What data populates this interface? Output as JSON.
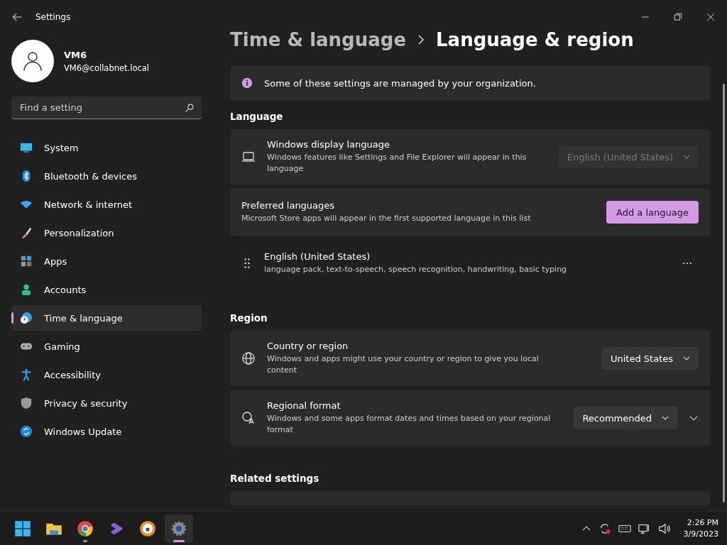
{
  "window": {
    "title": "Settings"
  },
  "user": {
    "name": "VM6",
    "email": "VM6@collabnet.local"
  },
  "search": {
    "placeholder": "Find a setting"
  },
  "sidebar": {
    "items": [
      {
        "label": "System",
        "selected": false
      },
      {
        "label": "Bluetooth & devices",
        "selected": false
      },
      {
        "label": "Network & internet",
        "selected": false
      },
      {
        "label": "Personalization",
        "selected": false
      },
      {
        "label": "Apps",
        "selected": false
      },
      {
        "label": "Accounts",
        "selected": false
      },
      {
        "label": "Time & language",
        "selected": true
      },
      {
        "label": "Gaming",
        "selected": false
      },
      {
        "label": "Accessibility",
        "selected": false
      },
      {
        "label": "Privacy & security",
        "selected": false
      },
      {
        "label": "Windows Update",
        "selected": false
      }
    ]
  },
  "breadcrumb": [
    "Time & language",
    "Language & region"
  ],
  "banner": "Some of these settings are managed by your organization.",
  "language": {
    "heading": "Language",
    "display": {
      "title": "Windows display language",
      "description": "Windows features like Settings and File Explorer will appear in this language",
      "value": "English (United States)",
      "disabled": true
    },
    "preferred": {
      "title": "Preferred languages",
      "description": "Microsoft Store apps will appear in the first supported language in this list",
      "button": "Add a language"
    },
    "languages": [
      {
        "name": "English (United States)",
        "features": "language pack, text-to-speech, speech recognition, handwriting, basic typing"
      }
    ]
  },
  "region": {
    "heading": "Region",
    "rows": [
      {
        "title": "Country or region",
        "description": "Windows and apps might use your country or region to give you local content",
        "value": "United States"
      },
      {
        "title": "Regional format",
        "description": "Windows and some apps format dates and times based on your regional format",
        "value": "Recommended",
        "expanded": false
      }
    ]
  },
  "related": {
    "heading": "Related settings"
  },
  "taskbar": {
    "apps": [
      {
        "running": false,
        "selected": false
      },
      {
        "running": false,
        "selected": false
      },
      {
        "running": true,
        "selected": false
      },
      {
        "running": false,
        "selected": false
      },
      {
        "running": false,
        "selected": false
      },
      {
        "running": true,
        "selected": true
      }
    ],
    "time": "2:26 PM",
    "date": "3/9/2023"
  }
}
